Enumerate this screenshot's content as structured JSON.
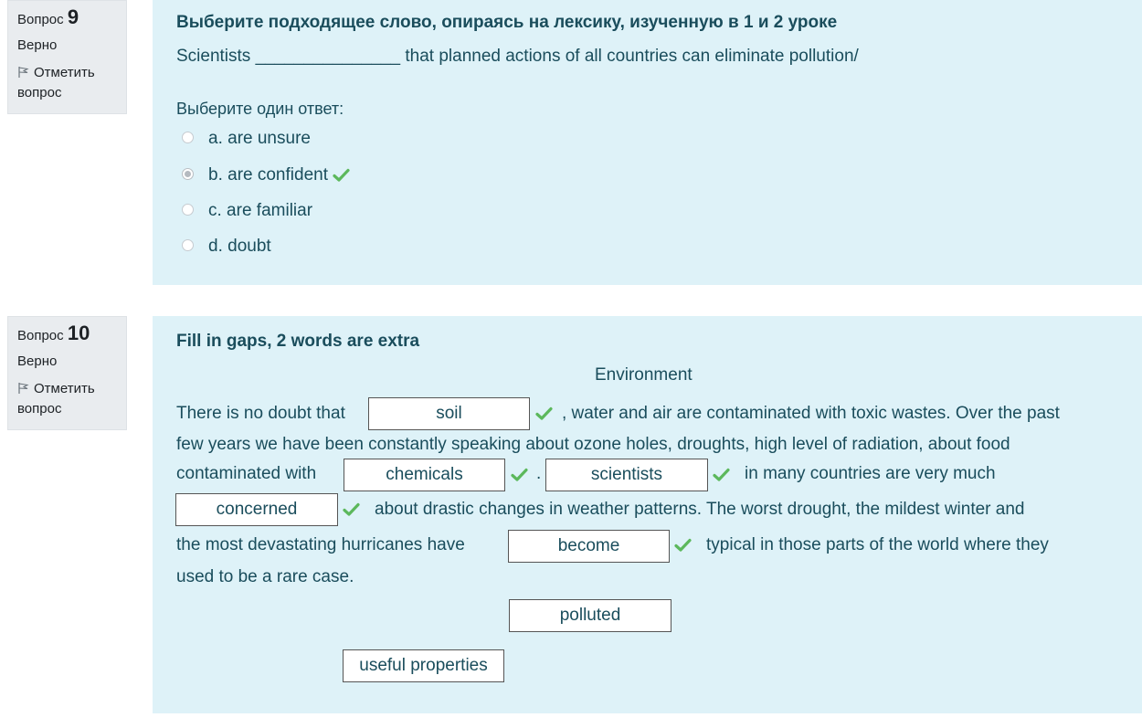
{
  "q9": {
    "label": "Вопрос",
    "number": "9",
    "state": "Верно",
    "flag_label": "Отметить вопрос",
    "title": "Выберите подходящее слово, опираясь на лексику, изученную в 1 и 2 уроке",
    "text": "Scientists _______________ that planned actions of all countries can eliminate pollution/",
    "prompt": "Выберите один ответ:",
    "options": [
      {
        "label": "a. are unsure",
        "checked": false
      },
      {
        "label": "b. are confident",
        "checked": true
      },
      {
        "label": "c. are familiar",
        "checked": false
      },
      {
        "label": "d. doubt",
        "checked": false
      }
    ]
  },
  "q10": {
    "label": "Вопрос",
    "number": "10",
    "state": "Верно",
    "flag_label": "Отметить вопрос",
    "title": "Fill in gaps, 2 words are extra",
    "subtitle": "Environment",
    "text_parts": {
      "p1": "There is no doubt that",
      "p2": ", water and air are contaminated with toxic wastes. Over the past",
      "p3": "few years we have been constantly speaking about ozone holes, droughts, high level of radiation, about food",
      "p4": "contaminated with",
      "p5": ".",
      "p6": "in many countries are very much",
      "p7": "about drastic changes in weather patterns. The worst drought, the mildest winter and",
      "p8": "the most devastating hurricanes have",
      "p9": "typical in those parts of the world where they",
      "p10": "used to be a rare case."
    },
    "drops": {
      "d1": "soil",
      "d2": "chemicals",
      "d3": "scientists",
      "d4": "concerned",
      "d5": "become"
    },
    "extra_words": [
      "polluted",
      "useful properties"
    ]
  },
  "colors": {
    "info_bg": "#e9ecef",
    "content_bg": "#def2f8",
    "text": "#1a4d5c",
    "check": "#5cb85c"
  }
}
